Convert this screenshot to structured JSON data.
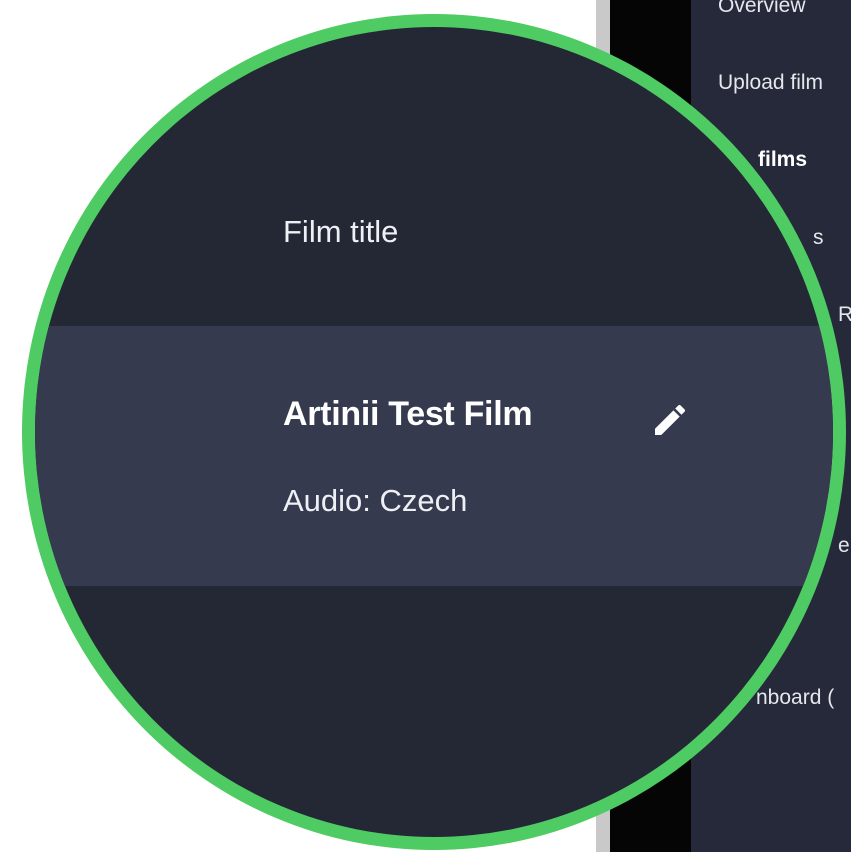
{
  "nav": {
    "items": [
      {
        "label": "Overview"
      },
      {
        "label": "Upload film"
      },
      {
        "label": "films",
        "active": true
      },
      {
        "label": "s"
      },
      {
        "label": "R"
      },
      {
        "label": "e"
      },
      {
        "label": "nboard ("
      }
    ]
  },
  "table": {
    "column_header": "Film title",
    "rows": [
      {
        "title": "Artinii Test Film",
        "audio_label": "Audio:",
        "audio_value": "Czech"
      }
    ]
  },
  "icons": {
    "edit": "pencil-icon"
  },
  "colors": {
    "lens_border": "#4ecb63",
    "panel_bg": "#242835",
    "row_bg": "#363a4f"
  }
}
